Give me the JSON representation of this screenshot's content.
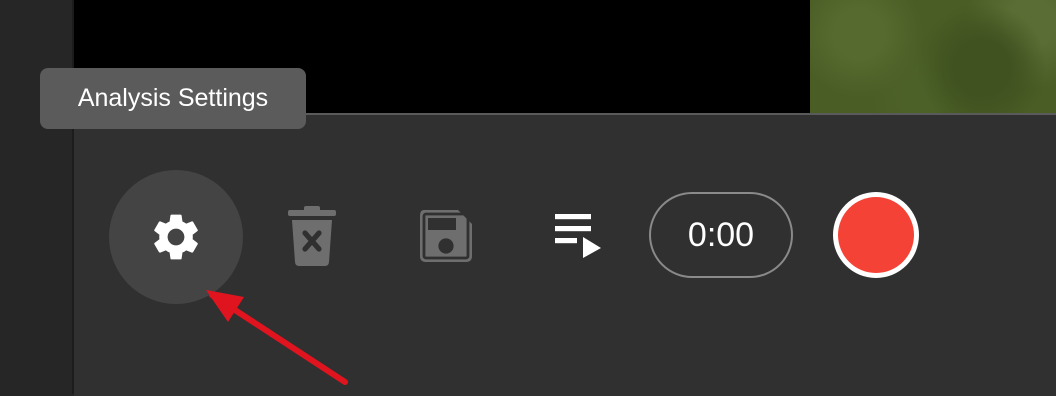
{
  "tooltip": {
    "text": "Analysis Settings"
  },
  "toolbar": {
    "settings_icon": "gear-icon",
    "delete_icon": "trash-x-icon",
    "save_icon": "floppy-disk-icon",
    "queue_icon": "playlist-play-icon",
    "timer": "0:00",
    "record_icon": "record-icon"
  },
  "annotation": {
    "type": "red-arrow",
    "points_to": "settings-button"
  },
  "colors": {
    "record": "#f44336",
    "arrow": "#e0141e",
    "icon_active": "#ffffff",
    "icon_disabled": "#6e6e6e"
  }
}
